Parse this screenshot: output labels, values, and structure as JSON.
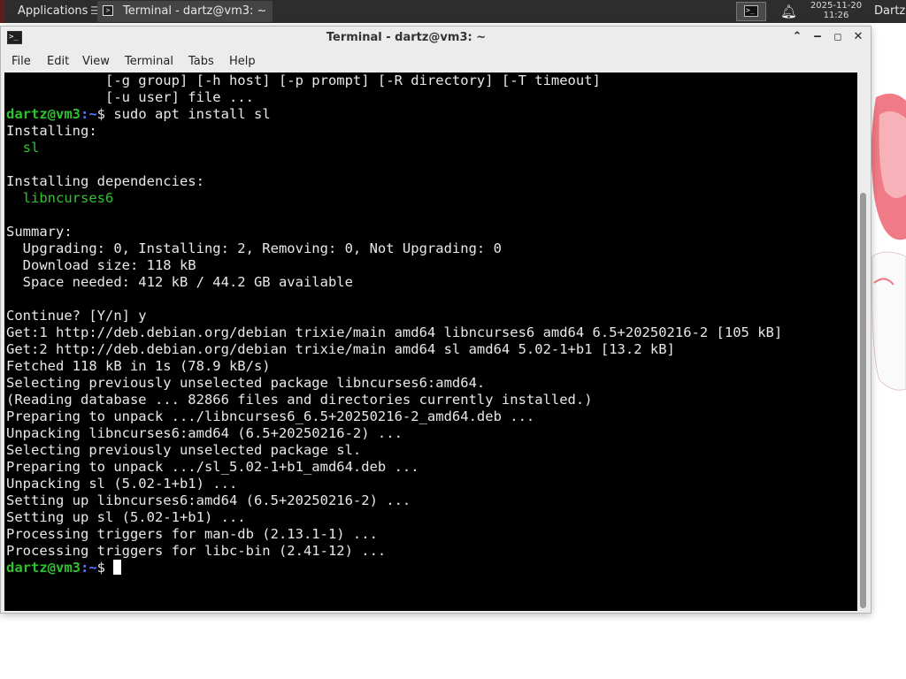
{
  "panel": {
    "applications_label": "Applications",
    "taskbar_item_label": "Terminal - dartz@vm3: ~",
    "clock_date": "2025-11-20",
    "clock_time": "11:26",
    "user_name": "Dartz"
  },
  "window": {
    "title": "Terminal - dartz@vm3: ~",
    "menu": [
      "File",
      "Edit",
      "View",
      "Terminal",
      "Tabs",
      "Help"
    ]
  },
  "terminal": {
    "prompt_user_host": "dartz@vm3",
    "prompt_path": ":~",
    "prompt_symbol": "$",
    "lines": [
      {
        "kind": "text",
        "text": "            [-g group] [-h host] [-p prompt] [-R directory] [-T timeout]"
      },
      {
        "kind": "text",
        "text": "            [-u user] file ..."
      },
      {
        "kind": "prompt",
        "command": " sudo apt install sl"
      },
      {
        "kind": "text",
        "text": "Installing:"
      },
      {
        "kind": "green",
        "text": "  sl"
      },
      {
        "kind": "text",
        "text": ""
      },
      {
        "kind": "text",
        "text": "Installing dependencies:"
      },
      {
        "kind": "green",
        "text": "  libncurses6"
      },
      {
        "kind": "text",
        "text": ""
      },
      {
        "kind": "text",
        "text": "Summary:"
      },
      {
        "kind": "text",
        "text": "  Upgrading: 0, Installing: 2, Removing: 0, Not Upgrading: 0"
      },
      {
        "kind": "text",
        "text": "  Download size: 118 kB"
      },
      {
        "kind": "text",
        "text": "  Space needed: 412 kB / 44.2 GB available"
      },
      {
        "kind": "text",
        "text": ""
      },
      {
        "kind": "text",
        "text": "Continue? [Y/n] y"
      },
      {
        "kind": "text",
        "text": "Get:1 http://deb.debian.org/debian trixie/main amd64 libncurses6 amd64 6.5+20250216-2 [105 kB]"
      },
      {
        "kind": "text",
        "text": "Get:2 http://deb.debian.org/debian trixie/main amd64 sl amd64 5.02-1+b1 [13.2 kB]"
      },
      {
        "kind": "text",
        "text": "Fetched 118 kB in 1s (78.9 kB/s)"
      },
      {
        "kind": "text",
        "text": "Selecting previously unselected package libncurses6:amd64."
      },
      {
        "kind": "text",
        "text": "(Reading database ... 82866 files and directories currently installed.)"
      },
      {
        "kind": "text",
        "text": "Preparing to unpack .../libncurses6_6.5+20250216-2_amd64.deb ..."
      },
      {
        "kind": "text",
        "text": "Unpacking libncurses6:amd64 (6.5+20250216-2) ..."
      },
      {
        "kind": "text",
        "text": "Selecting previously unselected package sl."
      },
      {
        "kind": "text",
        "text": "Preparing to unpack .../sl_5.02-1+b1_amd64.deb ..."
      },
      {
        "kind": "text",
        "text": "Unpacking sl (5.02-1+b1) ..."
      },
      {
        "kind": "text",
        "text": "Setting up libncurses6:amd64 (6.5+20250216-2) ..."
      },
      {
        "kind": "text",
        "text": "Setting up sl (5.02-1+b1) ..."
      },
      {
        "kind": "text",
        "text": "Processing triggers for man-db (2.13.1-1) ..."
      },
      {
        "kind": "text",
        "text": "Processing triggers for libc-bin (2.41-12) ..."
      },
      {
        "kind": "prompt",
        "command": " ",
        "cursor": true
      }
    ]
  },
  "colors": {
    "prompt_user": "#2ec22e",
    "prompt_path": "#5a78ff",
    "terminal_bg": "#000000",
    "terminal_fg": "#e8e8e8"
  },
  "icons": [
    "applications-menu-icon",
    "terminal-icon",
    "bell-icon",
    "minimize-icon",
    "maximize-icon",
    "close-icon",
    "unshade-icon"
  ]
}
